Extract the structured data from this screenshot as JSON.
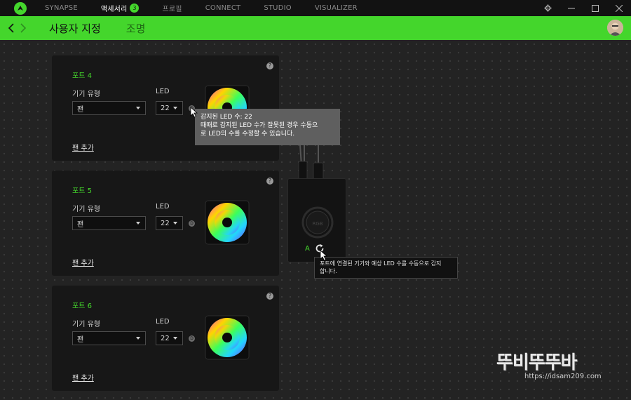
{
  "topbar": {
    "nav": [
      {
        "label": "SYNAPSE",
        "active": false
      },
      {
        "label": "액세서리",
        "active": true,
        "badge": "3"
      },
      {
        "label": "프로필",
        "active": false
      },
      {
        "label": "CONNECT",
        "active": false
      },
      {
        "label": "STUDIO",
        "active": false
      },
      {
        "label": "VISUALIZER",
        "active": false
      }
    ],
    "controls": [
      "gear-icon",
      "minimize-icon",
      "maximize-icon",
      "close-icon"
    ]
  },
  "header": {
    "title": "사용자 지정",
    "subtitle": "조명"
  },
  "ports": [
    {
      "title": "포트 4",
      "device_type_label": "기기 유형",
      "device_type_value": "팬",
      "led_label": "LED",
      "led_value": "22",
      "add_fan": "팬 추가"
    },
    {
      "title": "포트 5",
      "device_type_label": "기기 유형",
      "device_type_value": "팬",
      "led_label": "LED",
      "led_value": "22",
      "add_fan": "팬 추가"
    },
    {
      "title": "포트 6",
      "device_type_label": "기기 유형",
      "device_type_value": "팬",
      "led_label": "LED",
      "led_value": "22",
      "add_fan": "팬 추가"
    }
  ],
  "tooltip_led": {
    "line1": "감지된 LED 수: 22",
    "line2": "때때로 감지된 LED 수가 잘못된 경우 수동으",
    "line3": "로 LED의 수를 수정할 수 있습니다."
  },
  "controller": {
    "port_label": "A"
  },
  "tooltip_detect": {
    "line1": "포트에 연결된 기기와 예상 LED 수를 수동으로 감지",
    "line2": "합니다."
  },
  "watermark": {
    "title": "뚜비뚜뚜바",
    "url": "https://idsam209.com"
  },
  "colors": {
    "accent": "#44d62c",
    "background": "#222222",
    "card": "#171717"
  }
}
